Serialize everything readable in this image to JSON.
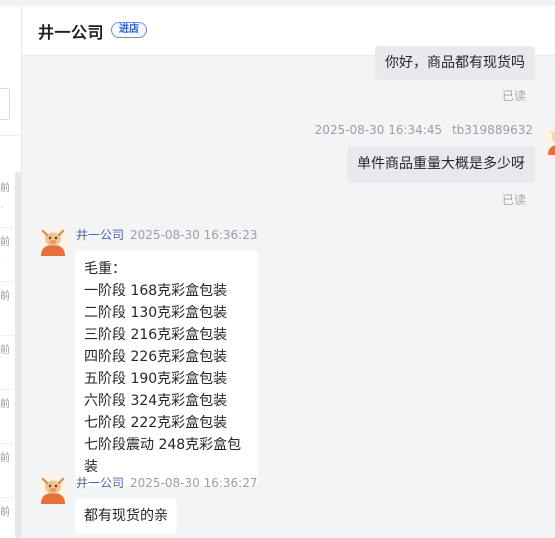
{
  "sidebar": {
    "time_fragments": [
      "前",
      "前",
      "前",
      "前",
      "前",
      "前",
      "前"
    ]
  },
  "header": {
    "shop_name": "井一公司",
    "enter_shop_label": "进店"
  },
  "messages": [
    {
      "side": "right",
      "text": "你好，商品都有现货吗",
      "read_status": "已读"
    },
    {
      "side": "right",
      "timestamp": "2025-08-30 16:34:45",
      "sender": "tb319889632",
      "text": "单件商品重量大概是多少呀",
      "read_status": "已读"
    },
    {
      "side": "left",
      "sender": "井一公司",
      "timestamp": "2025-08-30 16:36:23",
      "lines": [
        "毛重：",
        "一阶段 168克彩盒包装",
        "二阶段 130克彩盒包装",
        "三阶段 216克彩盒包装",
        "四阶段 226克彩盒包装",
        "五阶段 190克彩盒包装",
        "六阶段 324克彩盒包装",
        "七阶段 222克彩盒包装",
        "七阶段震动 248克彩盒包装"
      ]
    },
    {
      "side": "left",
      "sender": "井一公司",
      "timestamp": "2025-08-30 16:36:27",
      "text": "都有现货的亲"
    }
  ],
  "colors": {
    "accent": "#2f5bd6",
    "sender_name": "#4f65a8",
    "right_bubble": "#e8e9ec",
    "avatar_orange": "#e8703a"
  }
}
